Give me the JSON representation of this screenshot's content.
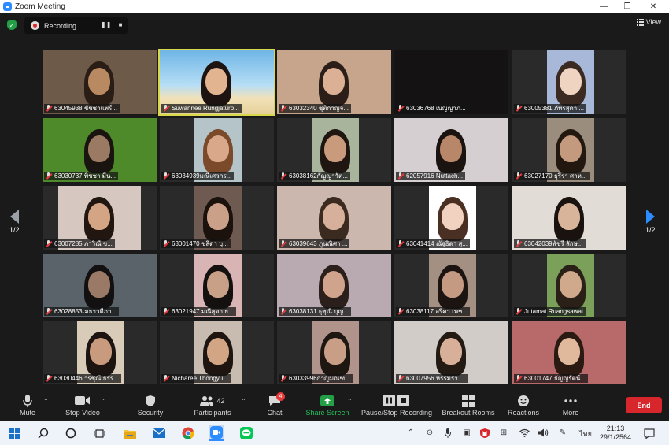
{
  "window": {
    "title": "Zoom Meeting",
    "minimize": "—",
    "restore": "❐",
    "close": "✕"
  },
  "recording": {
    "label": "Recording...",
    "pause": "❚❚",
    "stop": "■"
  },
  "view": {
    "label": "View"
  },
  "pager": {
    "left": "1/2",
    "right": "1/2"
  },
  "participants_tiles": [
    "63045938 ชัชชาแพร์...",
    "Suwannee Rungjaturo...",
    "63032340 ชุติกาญจ...",
    "63036768 เบญญาภ...",
    "63005381 ภัทรสุดา ...",
    "63030737 พิชชา มีน...",
    "63034939มณีเศวกร...",
    "63038162กัญญาวัต...",
    "62057916 Nuttach...",
    "63027170 ธุรีรา ศาห...",
    "63007285 ภาวิณี ข...",
    "63001470 ชลิดา บุ...",
    "63039643 ภูนณิศา ...",
    "63041414 ณัฐธิดา สุ...",
    "63042039พัชรี ลักษ...",
    "63028853เมธาวดีภา...",
    "63021947 มณีสุดา ย...",
    "63038131 ฐุชุณี บุญ...",
    "63038117 อริศา เพช...",
    "Jutamat Ruangsawat",
    "63030446 ารชุณี ธรร...",
    "Nicharee Thongyu...",
    "63033996กาญมณฑ...",
    "63007956 หรรมรา ...",
    "63001747 ธัญญรัตน์..."
  ],
  "toolbar": {
    "mute": "Mute",
    "stop_video": "Stop Video",
    "security": "Security",
    "participants": "Participants",
    "participants_count": "42",
    "chat": "Chat",
    "chat_badge": "4",
    "share_screen": "Share Screen",
    "pause_stop_recording": "Pause/Stop Recording",
    "breakout_rooms": "Breakout Rooms",
    "reactions": "Reactions",
    "more": "More",
    "end": "End"
  },
  "taskbar": {
    "language": "ไทย",
    "time": "21:13",
    "date": "29/1/2564"
  },
  "colors": {
    "accent": "#2d8cff",
    "share_green": "#23a047",
    "end_red": "#d7262c",
    "active_speaker": "#d8d848"
  }
}
